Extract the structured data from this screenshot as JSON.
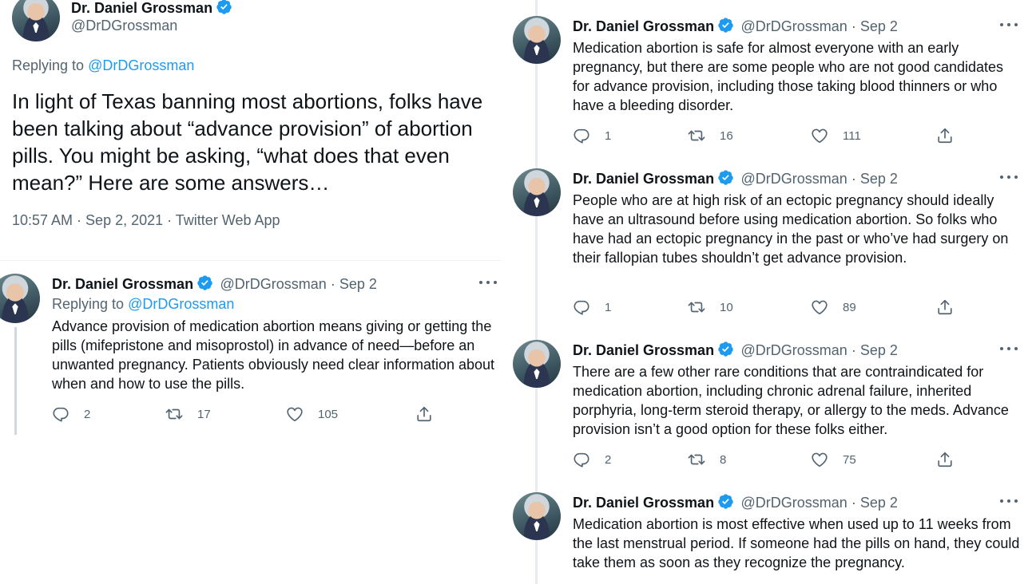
{
  "main": {
    "author": {
      "name": "Dr. Daniel Grossman",
      "handle": "@DrDGrossman"
    },
    "replying_prefix": "Replying to",
    "replying_to": "@DrDGrossman",
    "text": "In light of Texas banning most abortions, folks have been talking about “advance provision” of abortion pills. You might be asking, “what does that even mean?” Here are some answers…",
    "meta": "10:57 AM · Sep 2, 2021 · Twitter Web App"
  },
  "reply_left": {
    "name": "Dr. Daniel Grossman",
    "handle_date": "@DrDGrossman · Sep 2",
    "replying_prefix": "Replying to",
    "replying_to": "@DrDGrossman",
    "text": "Advance provision of medication abortion means giving or getting the pills (mifepristone and misoprostol) in advance of need—before an unwanted pregnancy. Patients obviously need clear information about when and how to use the pills.",
    "replies": "2",
    "retweets": "17",
    "likes": "105"
  },
  "thread": [
    {
      "name": "Dr. Daniel Grossman",
      "handle_date": "@DrDGrossman · Sep 2",
      "text": "Medication abortion is safe for almost everyone with an early pregnancy, but there are some people who are not good candidates for advance provision, including those taking blood thinners or who have a bleeding disorder.",
      "replies": "1",
      "retweets": "16",
      "likes": "111"
    },
    {
      "name": "Dr. Daniel Grossman",
      "handle_date": "@DrDGrossman · Sep 2",
      "text": "People who are at high risk of an ectopic pregnancy should ideally have an ultrasound before using medication abortion. So folks who have had an ectopic pregnancy in the past or who’ve had surgery on their fallopian tubes shouldn’t get advance provision.",
      "replies": "1",
      "retweets": "10",
      "likes": "89"
    },
    {
      "name": "Dr. Daniel Grossman",
      "handle_date": "@DrDGrossman · Sep 2",
      "text": "There are a few other rare conditions that are contraindicated for medication abortion, including chronic adrenal failure, inherited porphyria, long-term steroid therapy, or allergy to the meds. Advance provision isn’t a good option for these folks either.",
      "replies": "2",
      "retweets": "8",
      "likes": "75"
    },
    {
      "name": "Dr. Daniel Grossman",
      "handle_date": "@DrDGrossman · Sep 2",
      "text": "Medication abortion is most effective when used up to 11 weeks from the last menstrual period. If someone had the pills on hand, they could take them as soon as they recognize the pregnancy."
    }
  ],
  "colors": {
    "link": "#1d9bf0",
    "muted": "#536471",
    "text": "#0f1419",
    "verified": "#1d9bf0"
  },
  "icons": [
    "verified-badge-icon",
    "more-icon",
    "reply-icon",
    "retweet-icon",
    "like-icon",
    "share-icon"
  ]
}
